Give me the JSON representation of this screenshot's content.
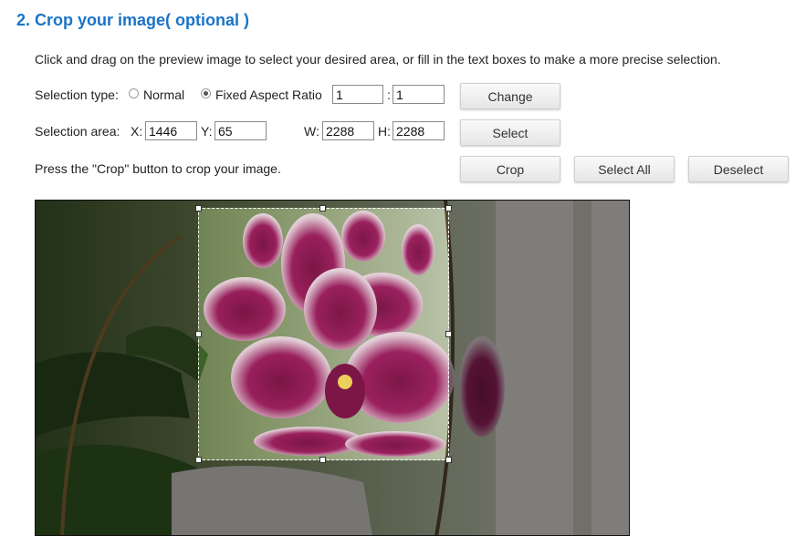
{
  "title": "2. Crop your image( optional )",
  "instructions": "Click and drag on the preview image to select your desired area, or fill in the text boxes to make a more precise selection.",
  "selection_type": {
    "label": "Selection type:",
    "normal_label": "Normal",
    "fixed_label": "Fixed Aspect Ratio",
    "selected": "Fixed Aspect Ratio",
    "ratio_w": "1",
    "ratio_sep": ":",
    "ratio_h": "1",
    "change_button": "Change"
  },
  "selection_area": {
    "label": "Selection area:",
    "x_label": "X:",
    "x_value": "1446",
    "y_label": "Y:",
    "y_value": "65",
    "w_label": "W:",
    "w_value": "2288",
    "h_label": "H:",
    "h_value": "2288",
    "select_button": "Select"
  },
  "crop_row": {
    "text": "Press the \"Crop\" button to crop your image.",
    "crop_button": "Crop",
    "select_all_button": "Select All",
    "deselect_button": "Deselect"
  },
  "colors": {
    "title": "#1a73c7",
    "petal": "#8e1552",
    "petal_white": "#f1eef0"
  }
}
